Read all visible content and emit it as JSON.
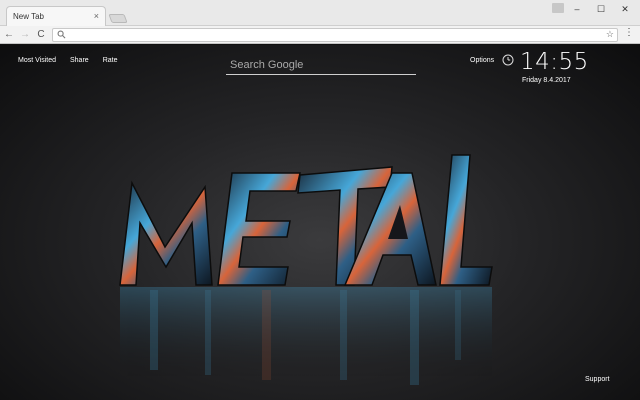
{
  "browser": {
    "tab": {
      "title": "New Tab",
      "close_icon": "×"
    },
    "window_controls": {
      "minimize": "–",
      "maximize": "☐",
      "close": "✕"
    },
    "toolbar": {
      "back": "←",
      "forward": "→",
      "reload": "C",
      "address_value": "",
      "star": "☆",
      "menu": "⋮"
    }
  },
  "newtab": {
    "links": {
      "most_visited": "Most Visited",
      "share": "Share",
      "rate": "Rate"
    },
    "search": {
      "placeholder": "Search Google"
    },
    "options": "Options",
    "clock": {
      "time": "14:55",
      "date": "Friday  8.4.2017"
    },
    "support": "Support",
    "artwork": {
      "text": "METAL"
    }
  },
  "colors": {
    "page_bg": "#1b1b1c",
    "metal_blue": "#46a7d8",
    "metal_orange": "#d8643a"
  }
}
